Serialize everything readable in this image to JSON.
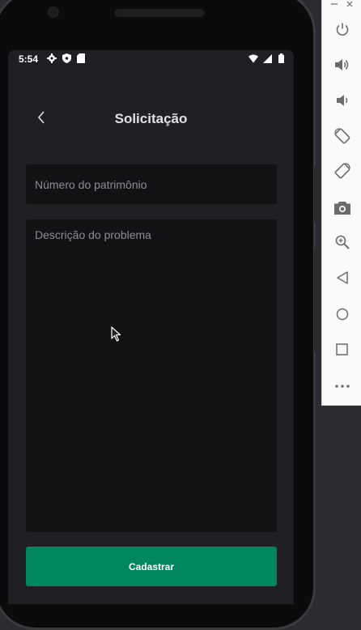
{
  "status_bar": {
    "time": "5:54",
    "left_icons": [
      "gear-icon",
      "shield-icon",
      "sd-card-icon"
    ],
    "right_icons": [
      "wifi-icon",
      "signal-icon",
      "battery-icon"
    ]
  },
  "header": {
    "title": "Solicitação",
    "back_icon": "chevron-left-icon"
  },
  "form": {
    "asset_number": {
      "placeholder": "Número do patrimônio",
      "value": ""
    },
    "problem_description": {
      "placeholder": "Descrição do problema",
      "value": ""
    }
  },
  "submit": {
    "label": "Cadastrar"
  },
  "colors": {
    "background": "#202024",
    "input_bg": "#121214",
    "placeholder": "#8d8d99",
    "title": "#e1e1e6",
    "accent": "#00875f"
  },
  "emulator_toolbar": {
    "titlebar": [
      "minimize-icon",
      "close-icon"
    ],
    "buttons": [
      "power-icon",
      "volume-up-icon",
      "volume-down-icon",
      "rotate-left-icon",
      "rotate-right-icon",
      "camera-icon",
      "zoom-icon",
      "back-icon",
      "home-icon",
      "overview-icon",
      "more-icon"
    ]
  }
}
